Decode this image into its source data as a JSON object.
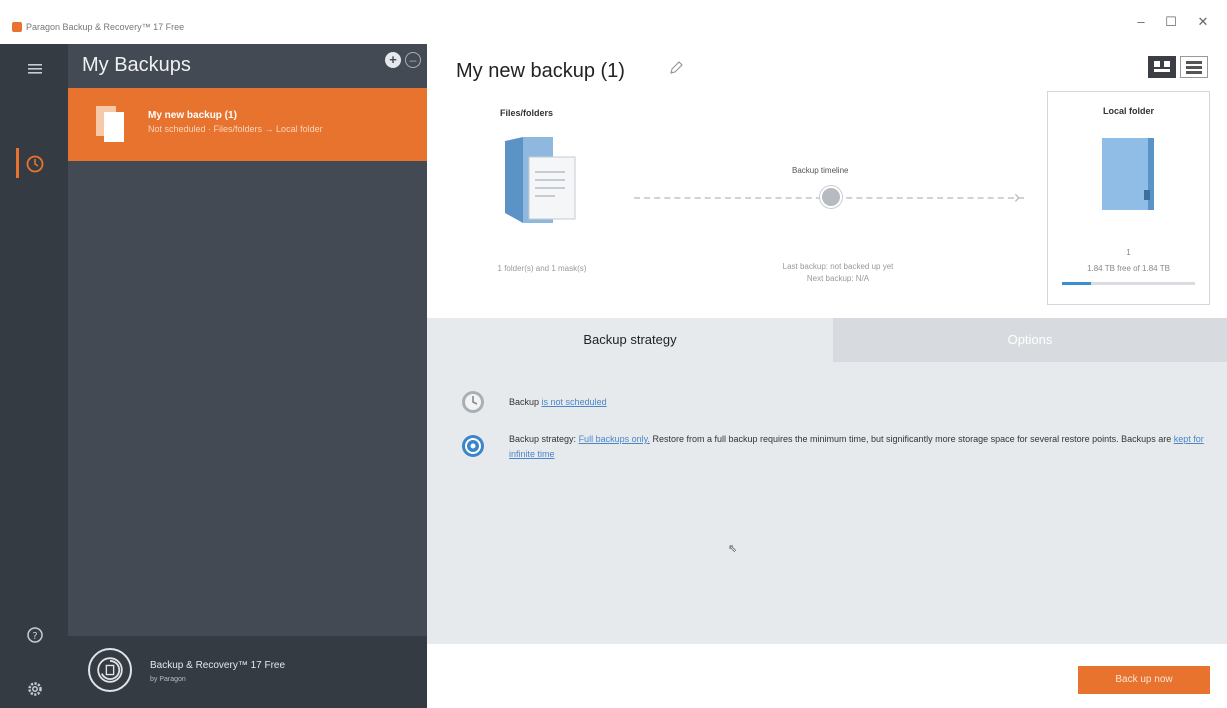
{
  "window": {
    "title": "Paragon Backup & Recovery™ 17 Free",
    "minimize": "–",
    "maximize": "☐",
    "close": "✕"
  },
  "rail": {
    "icons": [
      "menu-icon",
      "backups-icon",
      "help-icon",
      "settings-icon"
    ]
  },
  "panel": {
    "title": "My Backups",
    "add_glyph": "+",
    "collapse_glyph": "–",
    "items": [
      {
        "name": "My new backup (1)",
        "subtitle": "Not scheduled · Files/folders → Local folder"
      }
    ],
    "footer": {
      "product": "Backup & Recovery™ 17 Free",
      "vendor": "by Paragon"
    }
  },
  "main": {
    "title": "My new backup (1)",
    "source": {
      "label": "Files/folders",
      "caption": "1 folder(s) and 1 mask(s)"
    },
    "flow": {
      "label": "Backup timeline",
      "caption_line1": "Last backup: not backed up yet",
      "caption_line2": "Next backup: N/A"
    },
    "destination": {
      "label": "Local folder",
      "count": "1",
      "free": "1.84 TB free of 1.84 TB",
      "usage_fraction": 0.22
    },
    "tabs": [
      {
        "label": "Backup strategy",
        "active": true
      },
      {
        "label": "Options",
        "active": false
      }
    ],
    "strategy": {
      "schedule_prefix": "Backup",
      "schedule_link": "is not scheduled",
      "strategy_prefix": "Backup strategy:",
      "strategy_link": "Full backups only.",
      "strategy_text": "Restore from a full backup requires the minimum time, but significantly more storage space",
      "strategy_text2": "for several restore points. Backups are",
      "retention_link": "kept for infinite time"
    },
    "action_button": "Back up now"
  },
  "colors": {
    "accent": "#e8732e",
    "rail": "#353b43",
    "panel": "#434a53",
    "link": "#4a86c8"
  }
}
